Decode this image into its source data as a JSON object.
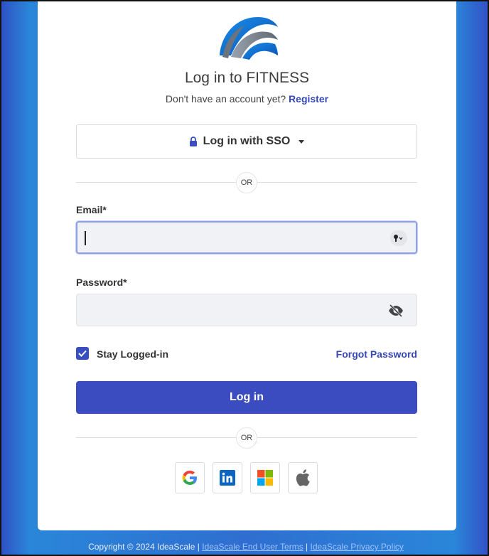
{
  "title": "Log in to FITNESS",
  "subtitle": {
    "text": "Don't have an account yet?",
    "register_link": "Register"
  },
  "sso": {
    "label": "Log in with SSO"
  },
  "divider_text": "OR",
  "email": {
    "label": "Email*",
    "value": "",
    "placeholder": ""
  },
  "password": {
    "label": "Password*",
    "value": "",
    "placeholder": ""
  },
  "remember": {
    "label": "Stay Logged-in",
    "checked": true
  },
  "forgot_password": "Forgot Password",
  "login_button": "Log in",
  "social": [
    "google-icon",
    "linkedin-icon",
    "microsoft-icon",
    "apple-icon"
  ],
  "footer": {
    "copyright": "Copyright © 2024 IdeaScale",
    "sep": "|",
    "terms": "IdeaScale End User Terms",
    "privacy": "IdeaScale Privacy Policy"
  },
  "colors": {
    "primary": "#3A4CBF",
    "link": "#3648B8",
    "background": "#2F6ED0"
  }
}
